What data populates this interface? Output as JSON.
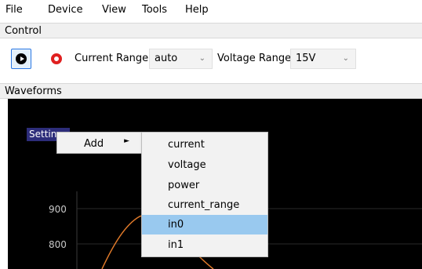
{
  "menubar": {
    "items": [
      "File",
      "Device",
      "View",
      "Tools",
      "Help"
    ]
  },
  "control": {
    "title": "Control",
    "play_icon": "play-icon",
    "record_icon": "record-icon",
    "current_range_label": "Current Range",
    "current_range_value": "auto",
    "voltage_range_label": "Voltage Range",
    "voltage_range_value": "15V"
  },
  "waveforms": {
    "title": "Waveforms",
    "settings_label": "Settings",
    "y_ticks": [
      "900",
      "800"
    ],
    "trace_color": "#e07a2a",
    "background": "#000000"
  },
  "context_menu": {
    "add_label": "Add"
  },
  "submenu": {
    "items": [
      "current",
      "voltage",
      "power",
      "current_range",
      "in0",
      "in1"
    ],
    "highlighted": "in0"
  }
}
